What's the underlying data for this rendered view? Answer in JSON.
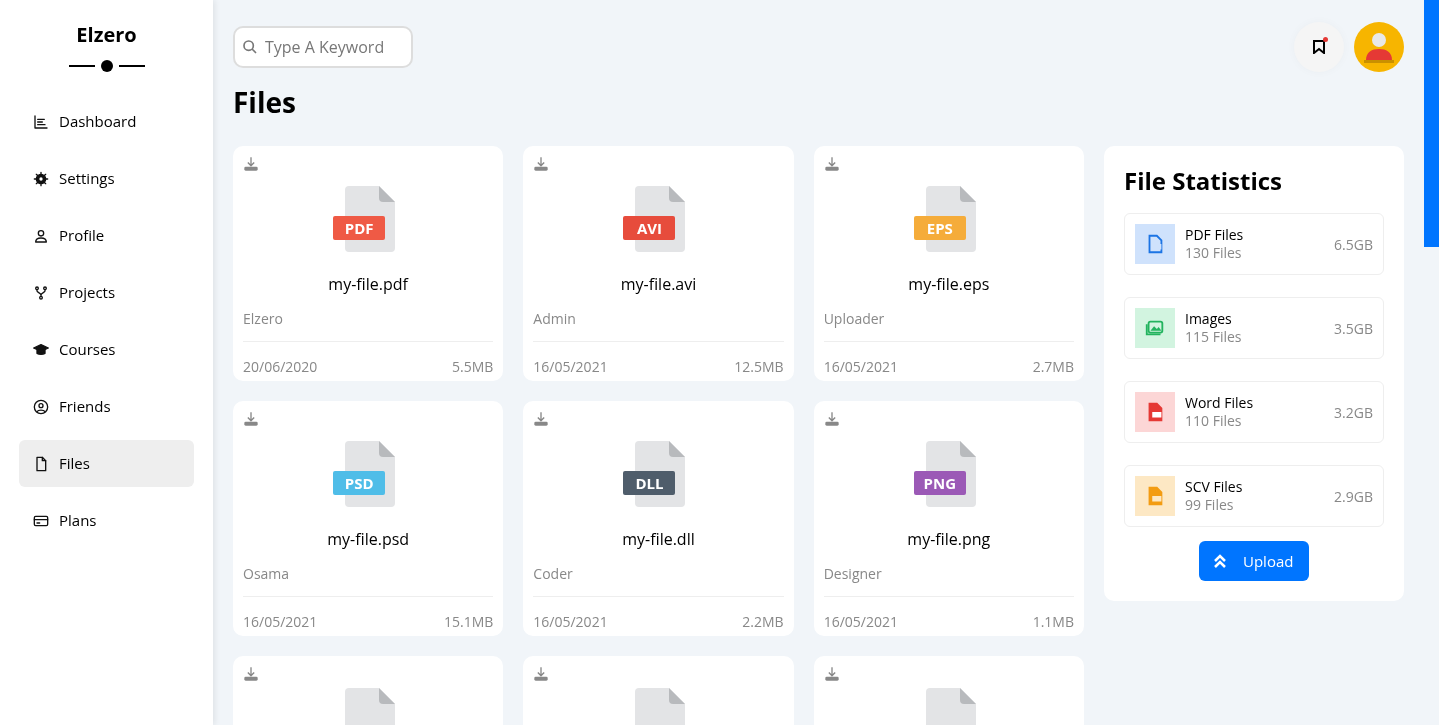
{
  "sidebar": {
    "brand": "Elzero",
    "items": [
      {
        "label": "Dashboard",
        "selected": false
      },
      {
        "label": "Settings",
        "selected": false
      },
      {
        "label": "Profile",
        "selected": false
      },
      {
        "label": "Projects",
        "selected": false
      },
      {
        "label": "Courses",
        "selected": false
      },
      {
        "label": "Friends",
        "selected": false
      },
      {
        "label": "Files",
        "selected": true
      },
      {
        "label": "Plans",
        "selected": false
      }
    ]
  },
  "search": {
    "placeholder": "Type A Keyword"
  },
  "header": {
    "notification": true
  },
  "page_title": "Files",
  "files": [
    {
      "kind": "full",
      "type": "PDF",
      "color": "#ef5a45",
      "name": "my-file.pdf",
      "owner": "Elzero",
      "date": "20/06/2020",
      "size": "5.5MB"
    },
    {
      "kind": "full",
      "type": "AVI",
      "color": "#e74c3c",
      "name": "my-file.avi",
      "owner": "Admin",
      "date": "16/05/2021",
      "size": "12.5MB"
    },
    {
      "kind": "full",
      "type": "EPS",
      "color": "#f5ac3a",
      "name": "my-file.eps",
      "owner": "Uploader",
      "date": "16/05/2021",
      "size": "2.7MB"
    },
    {
      "kind": "full",
      "type": "PSD",
      "color": "#4fbde8",
      "name": "my-file.psd",
      "owner": "Osama",
      "date": "16/05/2021",
      "size": "15.1MB"
    },
    {
      "kind": "full",
      "type": "DLL",
      "color": "#4f5d6b",
      "name": "my-file.dll",
      "owner": "Coder",
      "date": "16/05/2021",
      "size": "2.2MB"
    },
    {
      "kind": "full",
      "type": "PNG",
      "color": "#9b59b6",
      "name": "my-file.png",
      "owner": "Designer",
      "date": "16/05/2021",
      "size": "1.1MB"
    },
    {
      "kind": "clipped"
    },
    {
      "kind": "clipped"
    },
    {
      "kind": "clipped"
    }
  ],
  "statistics": {
    "title": "File Statistics",
    "items": [
      {
        "kind": "pdf",
        "name": "PDF Files",
        "count": "130 Files",
        "size": "6.5GB"
      },
      {
        "kind": "image",
        "name": "Images",
        "count": "115 Files",
        "size": "3.5GB"
      },
      {
        "kind": "word",
        "name": "Word Files",
        "count": "110 Files",
        "size": "3.2GB"
      },
      {
        "kind": "csv",
        "name": "SCV Files",
        "count": "99 Files",
        "size": "2.9GB"
      }
    ],
    "upload_button": "Upload"
  }
}
